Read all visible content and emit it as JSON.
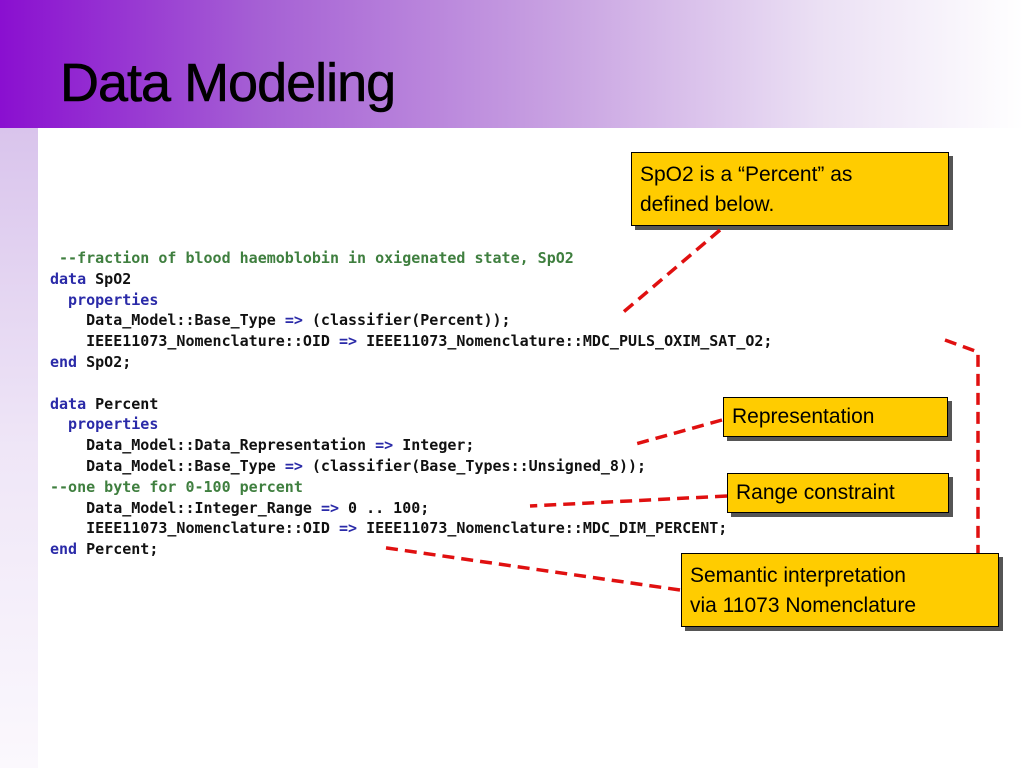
{
  "slide": {
    "title": "Data Modeling"
  },
  "code": {
    "lines": [
      [
        {
          "c": "cm",
          "t": " --fraction of blood haemoblobin in oxigenated state, SpO2"
        }
      ],
      [
        {
          "c": "kw",
          "t": "data"
        },
        {
          "c": "",
          "t": " SpO2"
        }
      ],
      [
        {
          "c": "kw",
          "t": "  properties"
        }
      ],
      [
        {
          "c": "",
          "t": "    Data_Model::Base_Type "
        },
        {
          "c": "kw",
          "t": "=>"
        },
        {
          "c": "",
          "t": " (classifier(Percent));"
        }
      ],
      [
        {
          "c": "",
          "t": "    IEEE11073_Nomenclature::OID "
        },
        {
          "c": "kw",
          "t": "=>"
        },
        {
          "c": "",
          "t": " IEEE11073_Nomenclature::MDC_PULS_OXIM_SAT_O2;"
        }
      ],
      [
        {
          "c": "kw",
          "t": "end"
        },
        {
          "c": "",
          "t": " SpO2;"
        }
      ],
      [
        {
          "c": "",
          "t": ""
        }
      ],
      [
        {
          "c": "kw",
          "t": "data"
        },
        {
          "c": "",
          "t": " Percent"
        }
      ],
      [
        {
          "c": "kw",
          "t": "  properties"
        }
      ],
      [
        {
          "c": "",
          "t": "    Data_Model::Data_Representation "
        },
        {
          "c": "kw",
          "t": "=>"
        },
        {
          "c": "",
          "t": " Integer;"
        }
      ],
      [
        {
          "c": "",
          "t": "    Data_Model::Base_Type "
        },
        {
          "c": "kw",
          "t": "=>"
        },
        {
          "c": "",
          "t": " (classifier(Base_Types::Unsigned_8));"
        }
      ],
      [
        {
          "c": "cm",
          "t": "--one byte for 0-100 percent"
        }
      ],
      [
        {
          "c": "",
          "t": "    Data_Model::Integer_Range "
        },
        {
          "c": "kw",
          "t": "=>"
        },
        {
          "c": "",
          "t": " 0 .. 100;"
        }
      ],
      [
        {
          "c": "",
          "t": "    IEEE11073_Nomenclature::OID "
        },
        {
          "c": "kw",
          "t": "=>"
        },
        {
          "c": "",
          "t": " IEEE11073_Nomenclature::MDC_DIM_PERCENT;"
        }
      ],
      [
        {
          "c": "kw",
          "t": "end"
        },
        {
          "c": "",
          "t": " Percent;"
        }
      ]
    ]
  },
  "callouts": {
    "spo2": {
      "line1": "SpO2 is a “Percent” as",
      "line2": "defined below."
    },
    "representation": "Representation",
    "range": "Range constraint",
    "semantic": {
      "line1": "Semantic interpretation",
      "line2": "via 11073 Nomenclature"
    }
  },
  "colors": {
    "callout_fill": "#ffcc00",
    "connector": "#e01010",
    "header_gradient_start": "#8a0fd0",
    "keyword": "#2a2aa8",
    "comment": "#3f7f3f"
  }
}
